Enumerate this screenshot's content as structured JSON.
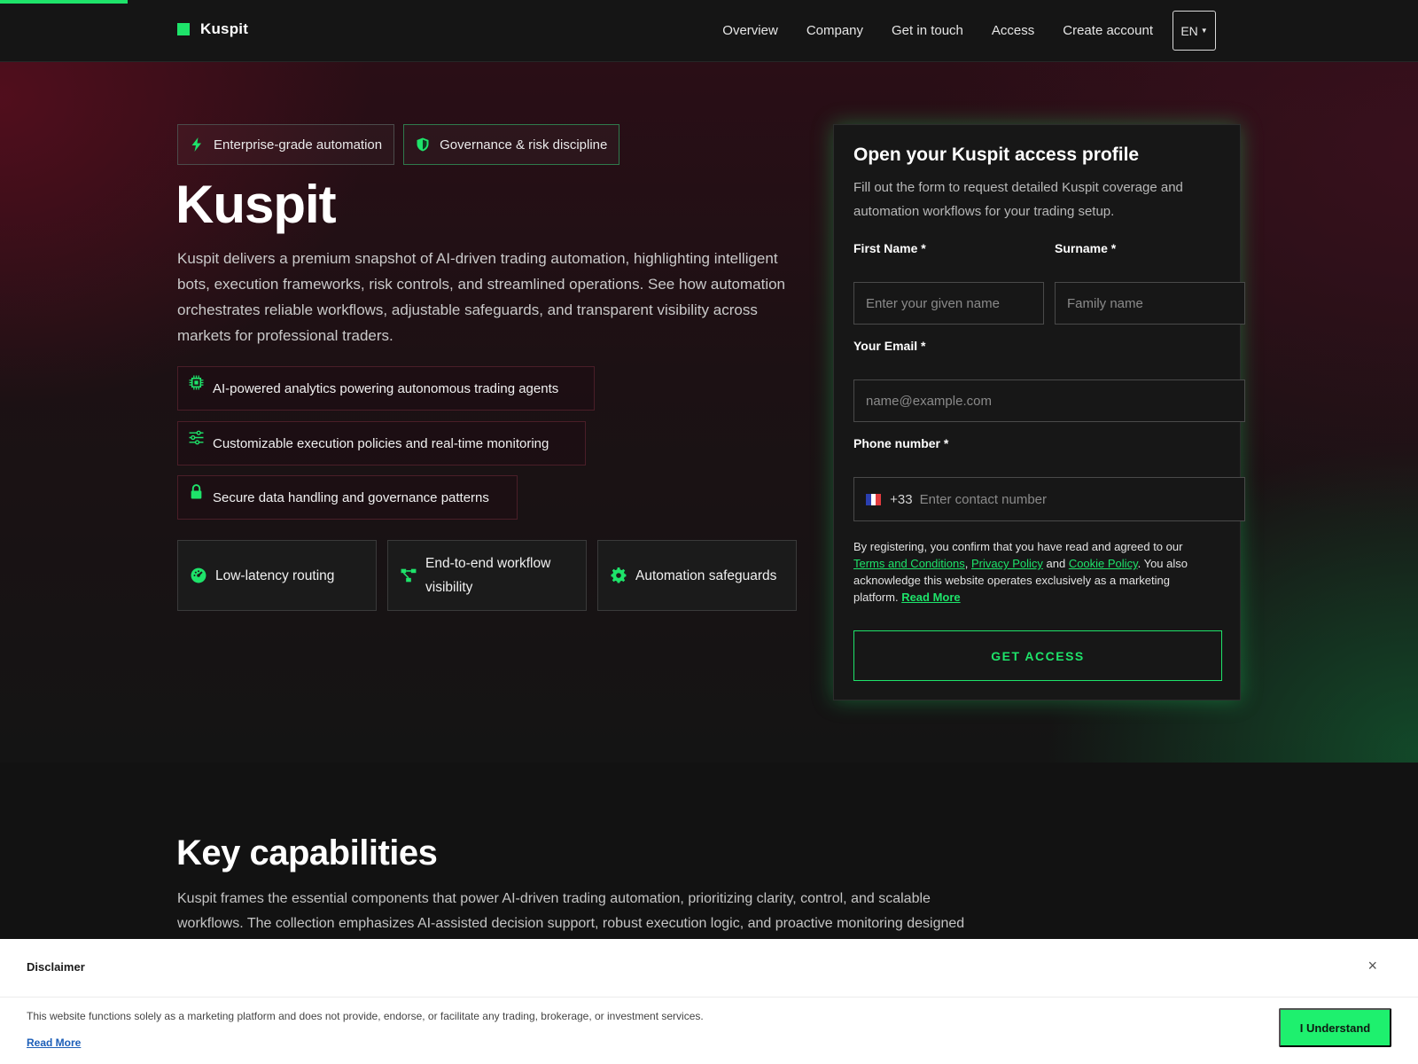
{
  "brand": {
    "name": "Kuspit"
  },
  "nav": {
    "items": [
      "Overview",
      "Company",
      "Get in touch",
      "Access",
      "Create account"
    ],
    "language": "EN"
  },
  "hero": {
    "pills": [
      "Enterprise-grade automation",
      "Governance & risk discipline"
    ],
    "title": "Kuspit",
    "description": "Kuspit delivers a premium snapshot of AI-driven trading automation, highlighting intelligent bots, execution frameworks, risk controls, and streamlined operations. See how automation orchestrates reliable workflows, adjustable safeguards, and transparent visibility across markets for professional traders.",
    "features": [
      {
        "icon": "chip-icon",
        "label": "AI-powered analytics powering autonomous trading agents"
      },
      {
        "icon": "sliders-icon",
        "label": "Customizable execution policies and real-time monitoring"
      },
      {
        "icon": "lock-icon",
        "label": "Secure data handling and governance patterns"
      }
    ],
    "cards": [
      {
        "icon": "gauge-icon",
        "label": "Low-latency routing"
      },
      {
        "icon": "workflow-icon",
        "label": "End-to-end workflow visibility"
      },
      {
        "icon": "gear-icon",
        "label": "Automation safeguards"
      }
    ]
  },
  "form": {
    "title": "Open your Kuspit access profile",
    "subtitle": "Fill out the form to request detailed Kuspit coverage and automation workflows for your trading setup.",
    "first_name_label": "First Name *",
    "first_name_placeholder": "Enter your given name",
    "surname_label": "Surname *",
    "surname_placeholder": "Family name",
    "email_label": "Your Email *",
    "email_placeholder": "name@example.com",
    "phone_label": "Phone number *",
    "phone_code": "+33",
    "phone_placeholder": "Enter contact number",
    "legal_prefix": "By registering, you confirm that you have read and agreed to our ",
    "terms": "Terms and Conditions",
    "comma": ", ",
    "privacy": "Privacy Policy",
    "and": " and ",
    "cookie": "Cookie Policy",
    "legal_suffix": ". You also acknowledge this website operates exclusively as a marketing platform. ",
    "read_more": "Read More",
    "submit": "GET ACCESS"
  },
  "capabilities": {
    "title": "Key capabilities",
    "description": "Kuspit frames the essential components that power AI-driven trading automation, prioritizing clarity, control, and scalable workflows. The collection emphasizes AI-assisted decision support, robust execution logic, and proactive monitoring designed"
  },
  "disclaimer": {
    "title": "Disclaimer",
    "close": "×",
    "text": "This website functions solely as a marketing platform and does not provide, endorse, or facilitate any trading, brokerage, or investment services.",
    "read_more": "Read More",
    "button": "I Understand"
  },
  "colors": {
    "accent": "#1ee36a",
    "background": "#121212"
  }
}
